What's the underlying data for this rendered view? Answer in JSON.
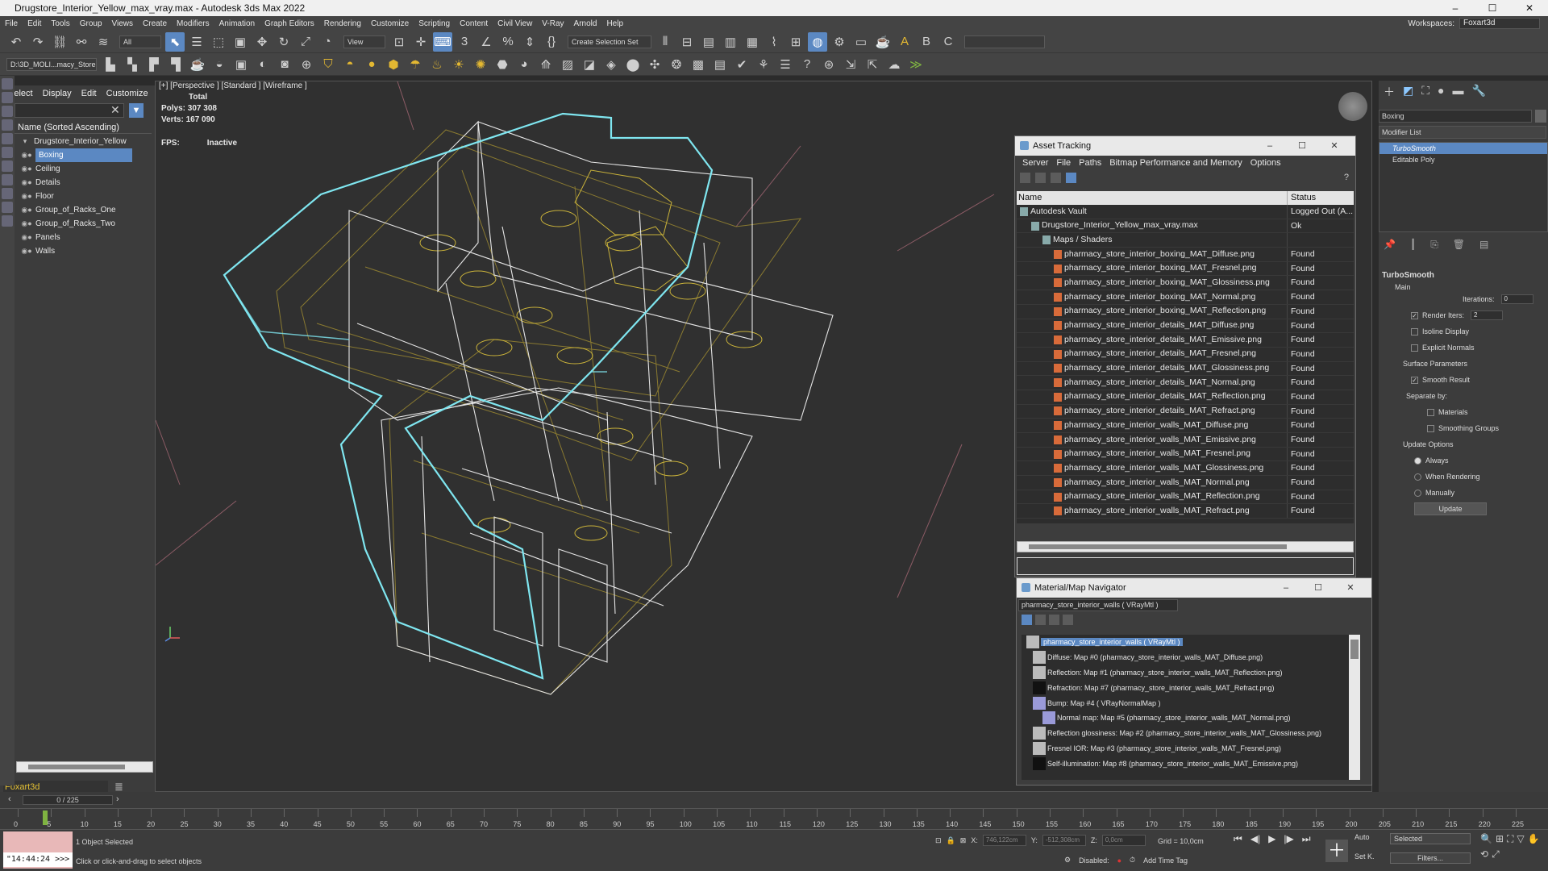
{
  "window": {
    "title": "Drugstore_Interior_Yellow_max_vray.max - Autodesk 3ds Max 2022",
    "minimize": "–",
    "maximize": "☐",
    "close": "✕"
  },
  "menu": [
    "File",
    "Edit",
    "Tools",
    "Group",
    "Views",
    "Create",
    "Modifiers",
    "Animation",
    "Graph Editors",
    "Rendering",
    "Customize",
    "Scripting",
    "Content",
    "Civil View",
    "V-Ray",
    "Arnold",
    "Help"
  ],
  "workspace": {
    "label": "Workspaces:",
    "value": "Foxart3d"
  },
  "toolbar": {
    "filter": "All",
    "view": "View",
    "selection_set": "Create Selection Set",
    "path": "D:\\3D_MOLI...macy_Store"
  },
  "scene_explorer": {
    "tabs": [
      "Select",
      "Display",
      "Edit",
      "Customize"
    ],
    "header": "Name (Sorted Ascending)",
    "root": "Drugstore_Interior_Yellow",
    "items": [
      "Boxing",
      "Ceiling",
      "Details",
      "Floor",
      "Group_of_Racks_One",
      "Group_of_Racks_Two",
      "Panels",
      "Walls"
    ],
    "selected_index": 0,
    "user": "Foxart3d"
  },
  "viewport": {
    "label": "[+] [Perspective ] [Standard ] [Wireframe ]",
    "stats_title": "Total",
    "polys_label": "Polys:",
    "polys": "307 308",
    "verts_label": "Verts:",
    "verts": "167 090",
    "fps_label": "FPS:",
    "fps": "Inactive"
  },
  "asset_tracking": {
    "title": "Asset Tracking",
    "menu": [
      "Server",
      "File",
      "Paths",
      "Bitmap Performance and Memory",
      "Options"
    ],
    "columns": [
      "Name",
      "Status"
    ],
    "rows": [
      {
        "name": "Autodesk Vault",
        "status": "Logged Out (A...",
        "indent": 0
      },
      {
        "name": "Drugstore_Interior_Yellow_max_vray.max",
        "status": "Ok",
        "indent": 1
      },
      {
        "name": "Maps / Shaders",
        "status": "",
        "indent": 2
      },
      {
        "name": "pharmacy_store_interior_boxing_MAT_Diffuse.png",
        "status": "Found",
        "indent": 3
      },
      {
        "name": "pharmacy_store_interior_boxing_MAT_Fresnel.png",
        "status": "Found",
        "indent": 3
      },
      {
        "name": "pharmacy_store_interior_boxing_MAT_Glossiness.png",
        "status": "Found",
        "indent": 3
      },
      {
        "name": "pharmacy_store_interior_boxing_MAT_Normal.png",
        "status": "Found",
        "indent": 3
      },
      {
        "name": "pharmacy_store_interior_boxing_MAT_Reflection.png",
        "status": "Found",
        "indent": 3
      },
      {
        "name": "pharmacy_store_interior_details_MAT_Diffuse.png",
        "status": "Found",
        "indent": 3
      },
      {
        "name": "pharmacy_store_interior_details_MAT_Emissive.png",
        "status": "Found",
        "indent": 3
      },
      {
        "name": "pharmacy_store_interior_details_MAT_Fresnel.png",
        "status": "Found",
        "indent": 3
      },
      {
        "name": "pharmacy_store_interior_details_MAT_Glossiness.png",
        "status": "Found",
        "indent": 3
      },
      {
        "name": "pharmacy_store_interior_details_MAT_Normal.png",
        "status": "Found",
        "indent": 3
      },
      {
        "name": "pharmacy_store_interior_details_MAT_Reflection.png",
        "status": "Found",
        "indent": 3
      },
      {
        "name": "pharmacy_store_interior_details_MAT_Refract.png",
        "status": "Found",
        "indent": 3
      },
      {
        "name": "pharmacy_store_interior_walls_MAT_Diffuse.png",
        "status": "Found",
        "indent": 3
      },
      {
        "name": "pharmacy_store_interior_walls_MAT_Emissive.png",
        "status": "Found",
        "indent": 3
      },
      {
        "name": "pharmacy_store_interior_walls_MAT_Fresnel.png",
        "status": "Found",
        "indent": 3
      },
      {
        "name": "pharmacy_store_interior_walls_MAT_Glossiness.png",
        "status": "Found",
        "indent": 3
      },
      {
        "name": "pharmacy_store_interior_walls_MAT_Normal.png",
        "status": "Found",
        "indent": 3
      },
      {
        "name": "pharmacy_store_interior_walls_MAT_Reflection.png",
        "status": "Found",
        "indent": 3
      },
      {
        "name": "pharmacy_store_interior_walls_MAT_Refract.png",
        "status": "Found",
        "indent": 3
      }
    ]
  },
  "material_navigator": {
    "title": "Material/Map Navigator",
    "current": "pharmacy_store_interior_walls  ( VRayMtl )",
    "items": [
      {
        "text": "pharmacy_store_interior_walls  ( VRayMtl )",
        "swatch": "grey",
        "sel": true
      },
      {
        "text": "Diffuse: Map #0 (pharmacy_store_interior_walls_MAT_Diffuse.png)",
        "swatch": "grey"
      },
      {
        "text": "Reflection: Map #1 (pharmacy_store_interior_walls_MAT_Reflection.png)",
        "swatch": "grey"
      },
      {
        "text": "Refraction: Map #7 (pharmacy_store_interior_walls_MAT_Refract.png)",
        "swatch": "black"
      },
      {
        "text": "Bump: Map #4  ( VRayNormalMap )",
        "swatch": "lilac"
      },
      {
        "text": "Normal map: Map #5 (pharmacy_store_interior_walls_MAT_Normal.png)",
        "swatch": "lilac"
      },
      {
        "text": "Reflection glossiness: Map #2 (pharmacy_store_interior_walls_MAT_Glossiness.png)",
        "swatch": "grey"
      },
      {
        "text": "Fresnel IOR: Map #3 (pharmacy_store_interior_walls_MAT_Fresnel.png)",
        "swatch": "grey"
      },
      {
        "text": "Self-illumination: Map #8 (pharmacy_store_interior_walls_MAT_Emissive.png)",
        "swatch": "black"
      }
    ]
  },
  "command_panel": {
    "object_name": "Boxing",
    "modifier_list": "Modifier List",
    "stack": [
      "TurboSmooth",
      "Editable Poly"
    ],
    "rollout": "TurboSmooth",
    "main": "Main",
    "iterations_label": "Iterations:",
    "iterations": "0",
    "render_iters_label": "Render Iters:",
    "render_iters": "2",
    "isoline": "Isoline Display",
    "explicit": "Explicit Normals",
    "surface": "Surface Parameters",
    "smooth": "Smooth Result",
    "separate": "Separate by:",
    "materials": "Materials",
    "groups": "Smoothing Groups",
    "update_opts": "Update Options",
    "always": "Always",
    "when_rendering": "When Rendering",
    "manually": "Manually",
    "update": "Update"
  },
  "timeline": {
    "slider": "0 / 225",
    "ticks": [
      "0",
      "5",
      "10",
      "15",
      "20",
      "25",
      "30",
      "35",
      "40",
      "45",
      "50",
      "55",
      "60",
      "65",
      "70",
      "75",
      "80",
      "85",
      "90",
      "95",
      "100",
      "105",
      "110",
      "115",
      "120",
      "125",
      "130",
      "135",
      "140",
      "145",
      "150",
      "155",
      "160",
      "165",
      "170",
      "175",
      "180",
      "185",
      "190",
      "195",
      "200",
      "205",
      "210",
      "215",
      "220",
      "225"
    ]
  },
  "status": {
    "clock": "\"14:44:24 >>>",
    "selected": "1 Object Selected",
    "hint": "Click or click-and-drag to select objects",
    "x_label": "X:",
    "x": "746,122cm",
    "y_label": "Y:",
    "y": "-512,308cm",
    "z_label": "Z:",
    "z": "0,0cm",
    "grid": "Grid = 10,0cm",
    "disabled": "Disabled:",
    "add_time_tag": "Add Time Tag",
    "auto": "Auto",
    "selected_dd": "Selected",
    "setk": "Set K.",
    "filters": "Filters..."
  }
}
